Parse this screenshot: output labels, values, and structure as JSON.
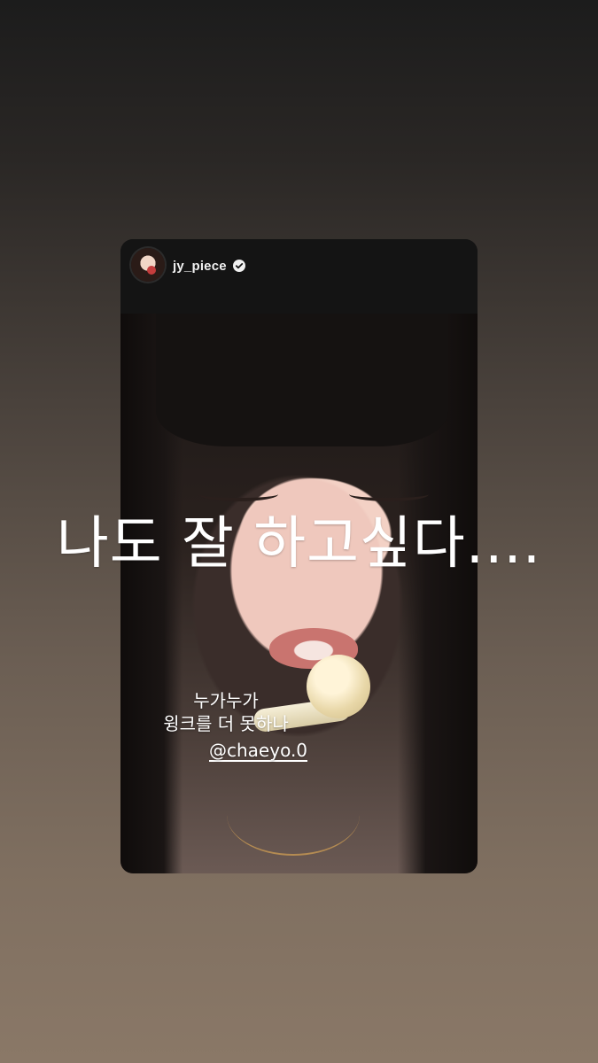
{
  "story": {
    "username": "jy_piece",
    "verified": true,
    "avatar_icon": "profile-avatar"
  },
  "captions": {
    "main": "나도 잘 하고싶다....",
    "sub_line1": "누가누가",
    "sub_line2": "윙크를 더 못하나",
    "mention": "@chaeyo.0"
  },
  "colors": {
    "background_top": "#1c1c1c",
    "background_bottom": "#8a7867",
    "text": "#ffffff"
  }
}
